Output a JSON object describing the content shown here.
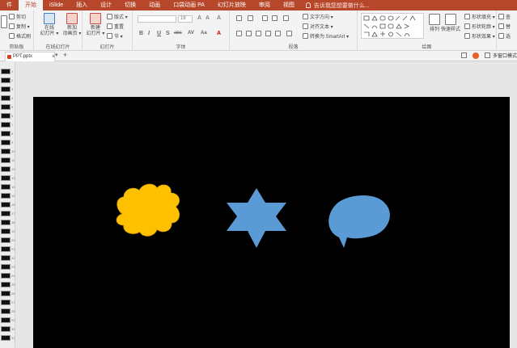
{
  "menu": {
    "items": [
      "件",
      "开始",
      "iSlide",
      "插入",
      "设计",
      "切换",
      "动画",
      "口袋动画 PA",
      "幻灯片放映",
      "审阅",
      "视图"
    ],
    "active_index": 1,
    "tell_me": "告诉我您想要做什么..."
  },
  "ribbon": {
    "clipboard": {
      "cut": "剪切",
      "copy": "复制 ▾",
      "format_painter": "格式刷",
      "label": "剪贴板"
    },
    "online": {
      "line1": "在线",
      "line2": "幻灯片 ▾",
      "new_line1": "新加",
      "new_line2": "动画页 ▾",
      "label": "在线幻灯片"
    },
    "slides": {
      "new_line1": "新建",
      "new_line2": "幻灯片 ▾",
      "layout": "版式 ▾",
      "reset": "重置",
      "section": "节 ▾",
      "label": "幻灯片"
    },
    "font": {
      "name": "",
      "size": "18",
      "bold": "B",
      "italic": "I",
      "underline": "U",
      "strike": "S",
      "abc": "abc",
      "spacing": "AV",
      "case": "Aa",
      "label": "字体"
    },
    "paragraph": {
      "text_direction": "文字方向 ▾",
      "align_text": "对齐文本 ▾",
      "smartart": "转换为 SmartArt ▾",
      "label": "段落"
    },
    "drawing": {
      "arrange": "排列",
      "quick_styles": "快速样式",
      "fill": "形状填充 ▾",
      "outline": "形状轮廓 ▾",
      "effects": "形状效果 ▾",
      "label": "绘图"
    },
    "editing": {
      "find": "查",
      "replace": "替",
      "select": "选"
    }
  },
  "tabbar": {
    "doc_name": "PPT.pptx",
    "close": "×",
    "nav": "▾",
    "add": "+",
    "multi_window": "多窗口模式"
  },
  "thumbnails": {
    "numbers": [
      "1",
      "2",
      "3",
      "4",
      "5",
      "6",
      "7",
      "8",
      "9",
      "10",
      "11",
      "12",
      "13",
      "14",
      "15",
      "16",
      "17",
      "18",
      "19",
      "20",
      "21",
      "22",
      "23",
      "24",
      "25",
      "26",
      "27",
      "28",
      "29",
      "30",
      "31"
    ]
  },
  "slide": {
    "background": "#000000",
    "shapes": [
      {
        "name": "cloud",
        "color": "#ffc000"
      },
      {
        "name": "six-point-star",
        "color": "#5b9bd5"
      },
      {
        "name": "oval-speech-callout",
        "color": "#5b9bd5"
      }
    ]
  },
  "colors": {
    "accent": "#b7472a",
    "ribbon": "#f3f3f3",
    "canvas": "#e6e6e6"
  }
}
